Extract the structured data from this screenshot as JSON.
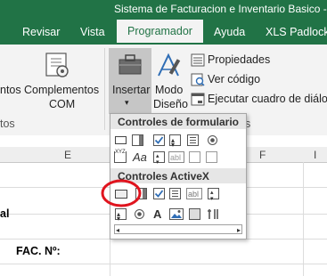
{
  "window": {
    "title": "Sistema de Facturacion e Inventario Basico - ..."
  },
  "tabs": [
    {
      "label": "Revisar"
    },
    {
      "label": "Vista"
    },
    {
      "label": "Programador"
    },
    {
      "label": "Ayuda"
    },
    {
      "label": "XLS Padlock"
    }
  ],
  "ribbon": {
    "cut_label_1": "ntos",
    "cut_label_2": "tos",
    "complementos_com_line1": "Complementos",
    "complementos_com_line2": "COM",
    "insertar_label": "Insertar",
    "modo_diseno_line1": "Modo",
    "modo_diseno_line2": "Diseño",
    "propiedades_label": "Propiedades",
    "ver_codigo_label": "Ver código",
    "ejecutar_label": "Ejecutar cuadro de diálogo",
    "group_cut": "s"
  },
  "insert_menu": {
    "form_controls_header": "Controles de formulario",
    "activex_controls_header": "Controles ActiveX",
    "form_controls": [
      {
        "icon": "button-control-icon"
      },
      {
        "icon": "combo-box-control-icon"
      },
      {
        "icon": "check-box-control-icon"
      },
      {
        "icon": "spin-button-control-icon"
      },
      {
        "icon": "list-box-control-icon"
      },
      {
        "icon": "option-button-control-icon"
      },
      {
        "icon": "group-box-control-icon"
      },
      {
        "icon": "label-control-icon"
      },
      {
        "icon": "scroll-bar-control-icon"
      },
      {
        "icon": "text-field-control-icon"
      },
      {
        "icon": "combo-list-edit-control-icon"
      },
      {
        "icon": "combo-drop-down-edit-control-icon"
      }
    ],
    "activex_controls": [
      {
        "icon": "command-button-icon"
      },
      {
        "icon": "combo-box-icon"
      },
      {
        "icon": "check-box-icon"
      },
      {
        "icon": "list-box-icon"
      },
      {
        "icon": "text-box-icon"
      },
      {
        "icon": "scroll-bar-icon"
      },
      {
        "icon": "spin-button-icon"
      },
      {
        "icon": "option-button-icon"
      },
      {
        "icon": "label-icon"
      },
      {
        "icon": "image-icon"
      },
      {
        "icon": "toggle-button-icon"
      },
      {
        "icon": "more-controls-icon"
      }
    ],
    "label_glyph": "A",
    "aa_glyph": "Aa",
    "xyz_glyph": "XYZ",
    "abl_glyph": "abl"
  },
  "sheet": {
    "columns": [
      "E",
      "F",
      "I"
    ],
    "cell_al": "al",
    "cell_fac": "FAC. Nº:"
  },
  "colors": {
    "excel_green": "#217346",
    "highlight_red": "#e0141e"
  }
}
